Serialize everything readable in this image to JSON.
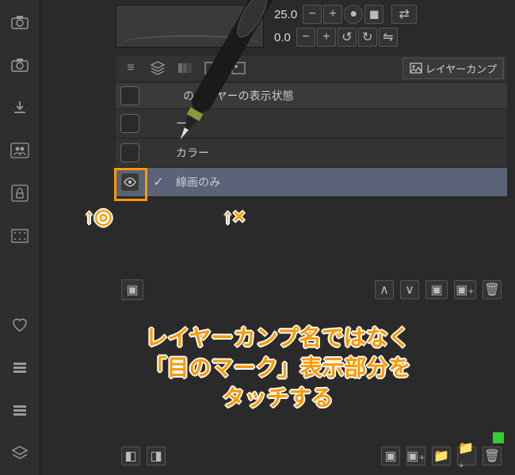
{
  "top": {
    "value1": "25.0",
    "value2": "0.0"
  },
  "tabs": {
    "layer_comp": "レイヤーカンプ"
  },
  "list": {
    "header": "のレイヤーの表示状態",
    "items": [
      {
        "name": "ー",
        "visible": false,
        "selected": false
      },
      {
        "name": "カラー",
        "visible": false,
        "selected": false
      },
      {
        "name": "線画のみ",
        "visible": true,
        "selected": true
      }
    ]
  },
  "annotations": {
    "arrow_good": "↑◎",
    "arrow_bad": "↑×",
    "caption_l1": "レイヤーカンプ名ではなく",
    "caption_l2": "「目のマーク」表示部分を",
    "caption_l3": "タッチする"
  },
  "sidebar_icons": [
    "camera",
    "camera",
    "download",
    "people",
    "lock",
    "grid",
    "heart",
    "list",
    "list",
    "layers"
  ]
}
